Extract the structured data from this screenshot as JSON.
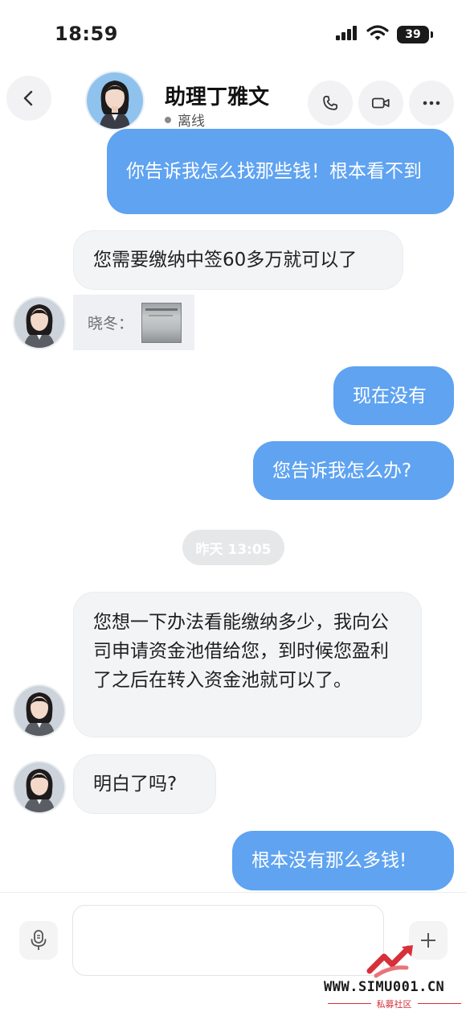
{
  "status_bar": {
    "time": "18:59",
    "battery": "39",
    "icons": [
      "signal-icon",
      "wifi-icon",
      "battery-icon"
    ]
  },
  "header": {
    "contact_name": "助理丁雅文",
    "presence": "离线",
    "presence_color": "#8a8a8a",
    "buttons": [
      "back-icon",
      "phone-icon",
      "video-icon",
      "more-icon"
    ]
  },
  "messages": [
    {
      "side": "sent",
      "text": "你告诉我怎么找那些钱！根本看不到"
    },
    {
      "side": "recv",
      "text": "您需要缴纳中签60多万就可以了"
    },
    {
      "side": "recv",
      "type": "quote",
      "quote_label": "晓冬："
    },
    {
      "side": "sent",
      "text": "现在没有"
    },
    {
      "side": "sent",
      "text": "您告诉我怎么办?"
    },
    {
      "side": "recv",
      "text": "您想一下办法看能缴纳多少，我向公司申请资金池借给您，到时候您盈利了之后在转入资金池就可以了。"
    },
    {
      "side": "recv",
      "text": "明白了吗?"
    },
    {
      "side": "sent",
      "text": "根本没有那么多钱!"
    }
  ],
  "time_separator": "昨天 13:05",
  "composer": {
    "value": "",
    "placeholder": "",
    "icons": [
      "microphone-icon",
      "plus-icon"
    ]
  },
  "watermark": {
    "site": "WWW.SIMU001.CN",
    "subtitle": "私募社区"
  },
  "colors": {
    "sent_bubble": "#5fa3f1",
    "recv_bubble": "#f3f4f6",
    "watermark_red": "#d6303a"
  }
}
